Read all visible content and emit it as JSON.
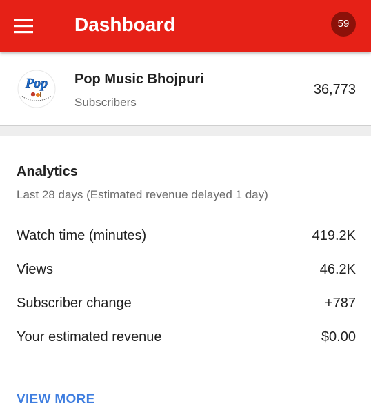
{
  "appbar": {
    "title": "Dashboard",
    "notification_count": "59",
    "color": "#e62117",
    "badge_color": "#8c1109",
    "menu_icon": "hamburger-menu-icon"
  },
  "channel": {
    "name": "Pop Music Bhojpuri",
    "subscribers_label": "Subscribers",
    "subscriber_count": "36,773",
    "avatar_logo_text": "Pop"
  },
  "analytics": {
    "title": "Analytics",
    "subtitle": "Last 28 days (Estimated revenue delayed 1 day)",
    "metrics": [
      {
        "label": "Watch time (minutes)",
        "value": "419.2K"
      },
      {
        "label": "Views",
        "value": "46.2K"
      },
      {
        "label": "Subscriber change",
        "value": "+787"
      },
      {
        "label": "Your estimated revenue",
        "value": "$0.00"
      }
    ],
    "view_more": "VIEW MORE",
    "link_color": "#3f7ee0"
  }
}
